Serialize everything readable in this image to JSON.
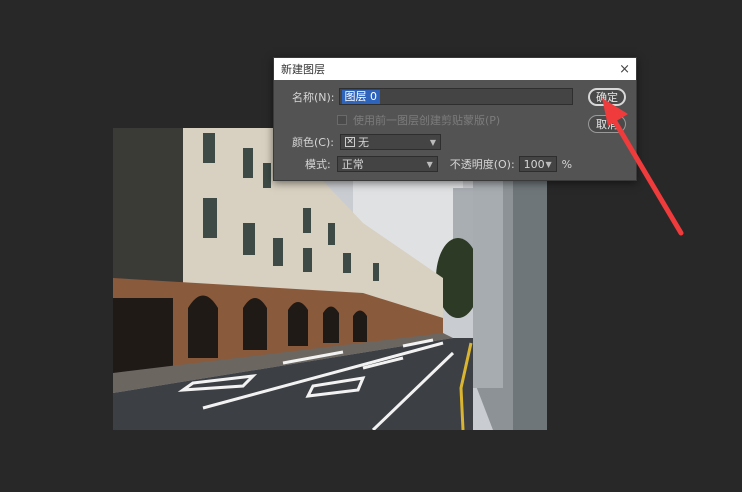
{
  "dialog": {
    "title": "新建图层",
    "close_glyph": "×",
    "name_label": "名称(N):",
    "name_value": "图层 0",
    "clip_checkbox_label": "使用前一图层创建剪贴蒙版(P)",
    "color_label": "颜色(C):",
    "color_value": "无",
    "color_icon": "x-box-icon",
    "mode_label": "模式:",
    "mode_value": "正常",
    "opacity_label": "不透明度(O):",
    "opacity_value": "100",
    "opacity_unit": "%",
    "ok_label": "确定",
    "cancel_label": "取消"
  },
  "annotation": {
    "arrow_color": "#ef3b3b",
    "arrow_target": "ok-button"
  },
  "colors": {
    "workspace": "#282828",
    "dialog_bg": "#535353",
    "selection": "#2f64bd"
  }
}
